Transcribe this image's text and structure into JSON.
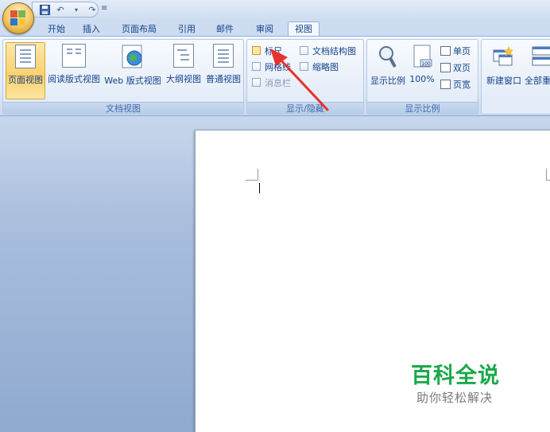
{
  "quick_access": {
    "more_glyph": "≡"
  },
  "tabs": [
    {
      "label": "开始",
      "active": false
    },
    {
      "label": "插入",
      "active": false
    },
    {
      "label": "页面布局",
      "active": false
    },
    {
      "label": "引用",
      "active": false
    },
    {
      "label": "邮件",
      "active": false
    },
    {
      "label": "审阅",
      "active": false
    },
    {
      "label": "视图",
      "active": true
    }
  ],
  "ribbon": {
    "doc_views": {
      "label": "文档视图",
      "buttons": [
        {
          "label": "页面视图",
          "active": true
        },
        {
          "label": "阅读版式视图"
        },
        {
          "label": "Web 版式视图"
        },
        {
          "label": "大纲视图"
        },
        {
          "label": "普通视图"
        }
      ]
    },
    "show_hide": {
      "label": "显示/隐藏",
      "items": [
        {
          "label": "标尺",
          "highlighted": true
        },
        {
          "label": "网格线"
        },
        {
          "label": "消息栏",
          "disabled": true
        },
        {
          "label": "文档结构图"
        },
        {
          "label": "缩略图"
        }
      ]
    },
    "zoom": {
      "label": "显示比例",
      "zoom_label": "显示比例",
      "percent_label": "100%",
      "one_page": "单页",
      "two_pages": "双页",
      "page_width": "页宽"
    },
    "window": {
      "new_window": "新建窗口",
      "arrange_all": "全部重"
    }
  },
  "watermark": {
    "title": "百科全说",
    "subtitle": "助你轻松解决"
  },
  "colors": {
    "accent": "#15428b",
    "highlight": "#fbd06a",
    "arrow": "#e8322c",
    "watermark_green": "#1aa84a"
  }
}
